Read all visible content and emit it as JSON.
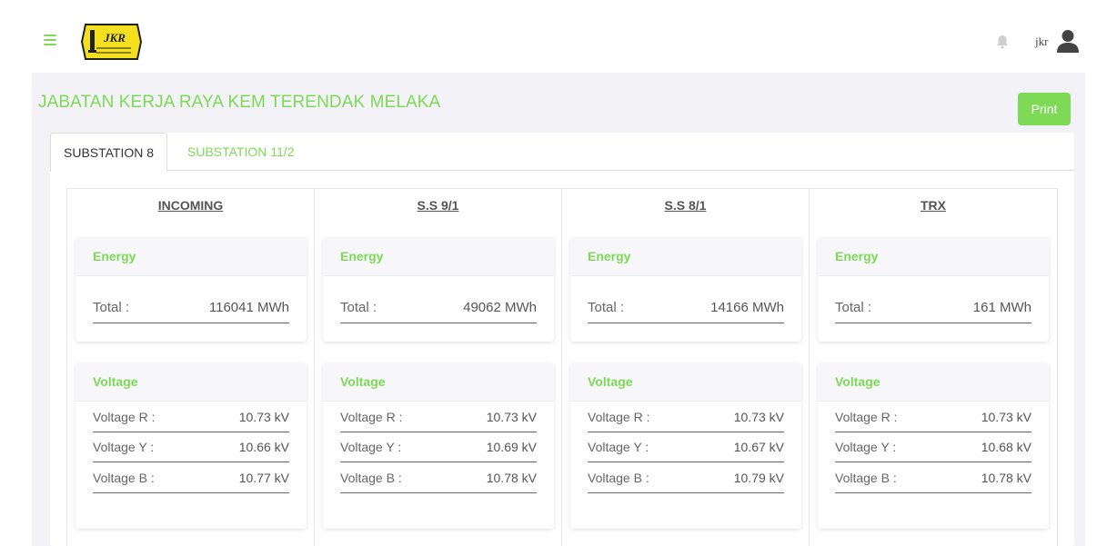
{
  "header": {
    "logo_text": "JKR",
    "username": "jkr"
  },
  "page": {
    "title": "JABATAN KERJA RAYA KEM TERENDAK MELAKA",
    "print_label": "Print"
  },
  "tabs": [
    {
      "label": "SUBSTATION 8",
      "active": true
    },
    {
      "label": "SUBSTATION 11/2",
      "active": false
    }
  ],
  "columns": [
    {
      "title": "INCOMING",
      "energy": {
        "heading": "Energy",
        "total_label": "Total :",
        "total_value": "116041 MWh"
      },
      "voltage": {
        "heading": "Voltage",
        "rows": [
          {
            "label": "Voltage R :",
            "value": "10.73 kV"
          },
          {
            "label": "Voltage Y :",
            "value": "10.66 kV"
          },
          {
            "label": "Voltage B :",
            "value": "10.77 kV"
          }
        ]
      }
    },
    {
      "title": "S.S 9/1",
      "energy": {
        "heading": "Energy",
        "total_label": "Total :",
        "total_value": "49062 MWh"
      },
      "voltage": {
        "heading": "Voltage",
        "rows": [
          {
            "label": "Voltage R :",
            "value": "10.73 kV"
          },
          {
            "label": "Voltage Y :",
            "value": "10.69 kV"
          },
          {
            "label": "Voltage B :",
            "value": "10.78 kV"
          }
        ]
      }
    },
    {
      "title": "S.S 8/1",
      "energy": {
        "heading": "Energy",
        "total_label": "Total :",
        "total_value": "14166 MWh"
      },
      "voltage": {
        "heading": "Voltage",
        "rows": [
          {
            "label": "Voltage R :",
            "value": "10.73 kV"
          },
          {
            "label": "Voltage Y :",
            "value": "10.67 kV"
          },
          {
            "label": "Voltage B :",
            "value": "10.79 kV"
          }
        ]
      }
    },
    {
      "title": "TRX",
      "energy": {
        "heading": "Energy",
        "total_label": "Total :",
        "total_value": "161 MWh"
      },
      "voltage": {
        "heading": "Voltage",
        "rows": [
          {
            "label": "Voltage R :",
            "value": "10.73 kV"
          },
          {
            "label": "Voltage Y :",
            "value": "10.68 kV"
          },
          {
            "label": "Voltage B :",
            "value": "10.78 kV"
          }
        ]
      }
    }
  ],
  "colors": {
    "accent": "#7ed957",
    "background": "#f2f2f7"
  },
  "icons": [
    "menu-icon",
    "bell-icon",
    "user-icon"
  ]
}
